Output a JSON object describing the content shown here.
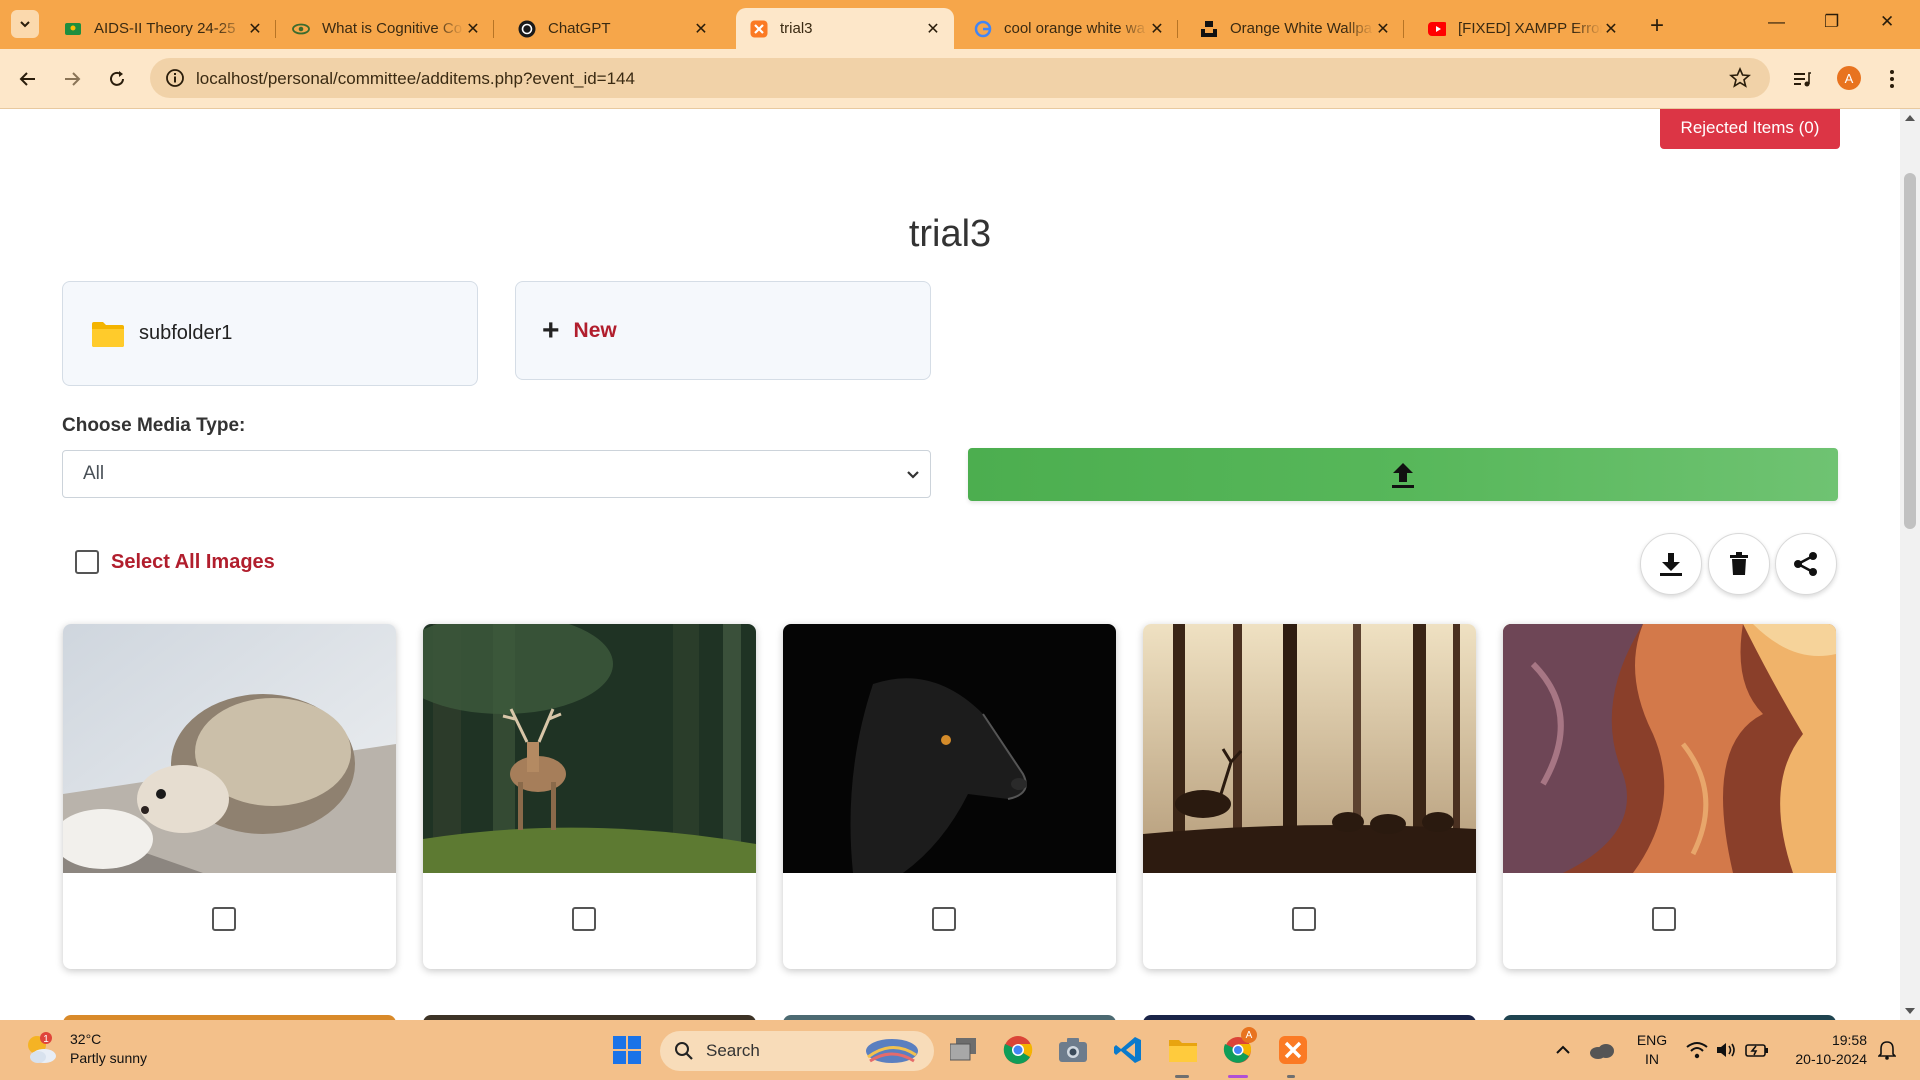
{
  "browser": {
    "tabs": [
      {
        "title": "AIDS-II Theory 24-25",
        "icon": "classroom-icon"
      },
      {
        "title": "What is Cognitive Co",
        "icon": "eye-icon"
      },
      {
        "title": "ChatGPT",
        "icon": "chatgpt-icon"
      },
      {
        "title": "trial3",
        "icon": "xampp-icon",
        "active": true
      },
      {
        "title": "cool orange white wa",
        "icon": "google-icon"
      },
      {
        "title": "Orange White Wallpa",
        "icon": "unsplash-icon"
      },
      {
        "title": "[FIXED] XAMPP Error",
        "icon": "youtube-icon"
      }
    ],
    "url": "localhost/personal/committee/additems.php?event_id=144",
    "profile_initial": "A"
  },
  "page": {
    "rejected_button": "Rejected Items (0)",
    "title": "trial3",
    "folders": [
      {
        "name": "subfolder1"
      }
    ],
    "new_label": "New",
    "media_label": "Choose Media Type:",
    "media_selected": "All",
    "select_all_label": "Select All Images",
    "actions": [
      "download-icon",
      "trash-icon",
      "share-icon"
    ],
    "images": [
      {
        "subject": "hedgehog"
      },
      {
        "subject": "deer"
      },
      {
        "subject": "black dog"
      },
      {
        "subject": "forest silhouette"
      },
      {
        "subject": "canyon"
      }
    ]
  },
  "taskbar": {
    "weather_temp": "32°C",
    "weather_desc": "Partly sunny",
    "weather_badge": "1",
    "search_label": "Search",
    "lang_top": "ENG",
    "lang_bottom": "IN",
    "time": "19:58",
    "date": "20-10-2024",
    "chrome_badge": "A"
  },
  "colors": {
    "tabstrip": "#f6a64a",
    "toolbar": "#fde7c9",
    "danger": "#dc3545",
    "accent_red_text": "#b11e2d",
    "upload_green": "#57b75a",
    "taskbar": "#f3c08a"
  }
}
